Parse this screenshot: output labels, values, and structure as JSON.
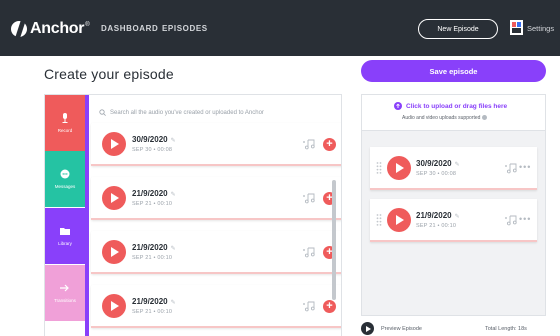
{
  "header": {
    "logo_text": "Anchor",
    "logo_reg": "®",
    "nav": [
      "DASHBOARD",
      "EPISODES"
    ],
    "new_episode_label": "New Episode",
    "settings_label": "Settings"
  },
  "page_title": "Create your episode",
  "side_tabs": [
    {
      "label": "Record",
      "icon": "microphone-icon",
      "color": "#ef5b5b"
    },
    {
      "label": "Messages",
      "icon": "message-icon",
      "color": "#25c3a3"
    },
    {
      "label": "Library",
      "icon": "folder-icon",
      "color": "#8940fa"
    },
    {
      "label": "Transitions",
      "icon": "arrow-right-icon",
      "color": "#f0a0d8"
    }
  ],
  "search": {
    "placeholder": "Search all the audio you've created or uploaded to Anchor"
  },
  "library_items": [
    {
      "title": "30/9/2020",
      "subtitle": "SEP 30 • 00:08"
    },
    {
      "title": "21/9/2020",
      "subtitle": "SEP 21 • 00:10"
    },
    {
      "title": "21/9/2020",
      "subtitle": "SEP 21 • 00:10"
    },
    {
      "title": "21/9/2020",
      "subtitle": "SEP 21 • 00:10"
    }
  ],
  "right_panel": {
    "save_label": "Save episode",
    "upload_link": "Click to upload or drag files here",
    "upload_sub": "Audio and video uploads supported",
    "segments": [
      {
        "title": "30/9/2020",
        "subtitle": "SEP 30 • 00:08"
      },
      {
        "title": "21/9/2020",
        "subtitle": "SEP 21 • 00:10"
      }
    ],
    "preview_label": "Preview Episode",
    "total_length": "Total Length: 18s"
  },
  "colors": {
    "header_bg": "#292f36",
    "accent_purple": "#8940fa",
    "play_red": "#ef5b5b",
    "messages_green": "#25c3a3",
    "transitions_pink": "#f0a0d8"
  }
}
